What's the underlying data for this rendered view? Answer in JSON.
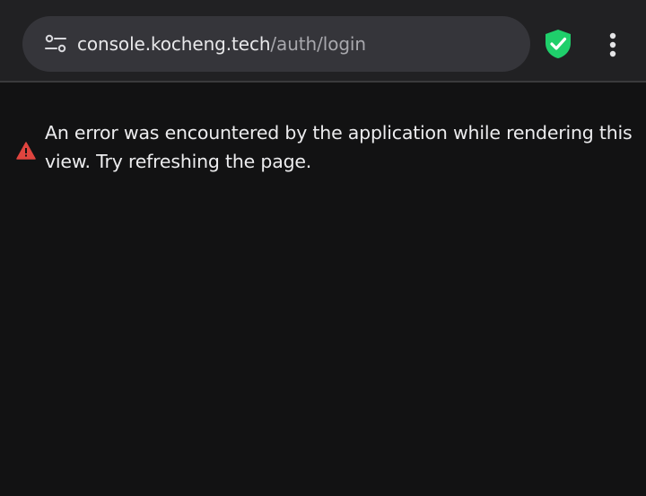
{
  "address_bar": {
    "host": "console.kocheng.tech",
    "path": "/auth/login",
    "site_info_icon": "tune-icon",
    "security_icon": "shield-check-icon",
    "security_color": "#1fcf6b",
    "menu_icon": "more-vert-icon"
  },
  "page": {
    "error_icon": "warning-icon",
    "error_icon_color": "#e0453f",
    "error_message": "An error was encountered by the application while rendering this view. Try refreshing the page."
  }
}
